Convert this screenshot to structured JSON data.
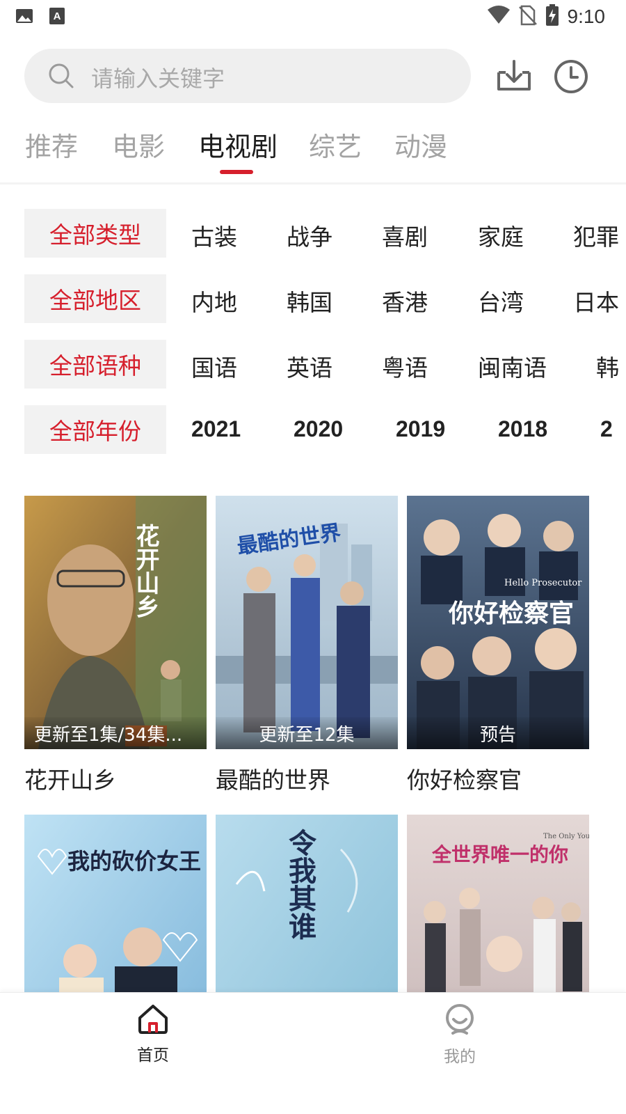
{
  "status_bar": {
    "time": "9:10",
    "left_icons": [
      "gallery-icon",
      "text-a-icon"
    ],
    "right_icons": [
      "wifi-icon",
      "no-sim-icon",
      "battery-charging-icon"
    ]
  },
  "search": {
    "placeholder": "请输入关键字",
    "icon": "search-icon",
    "actions": [
      "download-icon",
      "history-clock-icon"
    ]
  },
  "tabs": [
    {
      "label": "推荐",
      "active": false
    },
    {
      "label": "电影",
      "active": false
    },
    {
      "label": "电视剧",
      "active": true
    },
    {
      "label": "综艺",
      "active": false
    },
    {
      "label": "动漫",
      "active": false
    }
  ],
  "filters": {
    "type": {
      "selected": "全部类型",
      "options": [
        "古装",
        "战争",
        "喜剧",
        "家庭",
        "犯罪"
      ]
    },
    "region": {
      "selected": "全部地区",
      "options": [
        "内地",
        "韩国",
        "香港",
        "台湾",
        "日本"
      ]
    },
    "language": {
      "selected": "全部语种",
      "options": [
        "国语",
        "英语",
        "粤语",
        "闽南语",
        "韩"
      ]
    },
    "year": {
      "selected": "全部年份",
      "options": [
        "2021",
        "2020",
        "2019",
        "2018",
        "2"
      ]
    }
  },
  "colors": {
    "accent": "#d61f2c",
    "tab_inactive": "#a3a3a3",
    "filter_bg": "#f2f2f2"
  },
  "posters": [
    {
      "title": "花开山乡",
      "badge": "更新至1集/34集...",
      "poster_text": "花开山乡"
    },
    {
      "title": "最酷的世界",
      "badge": "更新至12集",
      "poster_text": "最酷的世界"
    },
    {
      "title": "你好检察官",
      "badge": "预告",
      "poster_text": "你好检察官",
      "poster_subtext": "Hello Prosecutor"
    },
    {
      "title": "",
      "badge": "",
      "poster_text": "我的砍价女王"
    },
    {
      "title": "",
      "badge": "",
      "poster_text": "令我其谁"
    },
    {
      "title": "",
      "badge": "",
      "poster_text": "全世界唯一的你",
      "poster_subtext": "The Only You"
    }
  ],
  "bottom_nav": [
    {
      "label": "首页",
      "icon": "home-icon",
      "active": true
    },
    {
      "label": "我的",
      "icon": "profile-icon",
      "active": false
    }
  ]
}
